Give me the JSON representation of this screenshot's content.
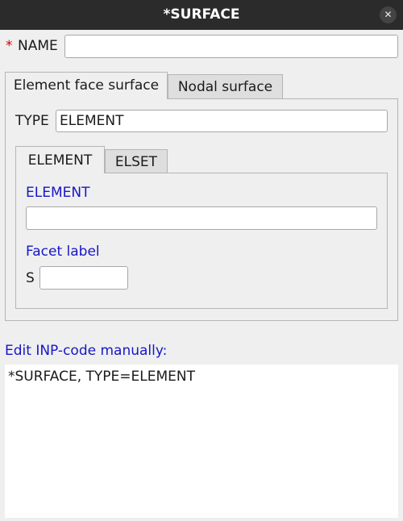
{
  "window": {
    "title": "*SURFACE",
    "close_glyph": "✕"
  },
  "name_field": {
    "required_marker": "*",
    "label": "NAME",
    "value": ""
  },
  "outer_tabs": [
    {
      "label": "Element face surface",
      "active": true
    },
    {
      "label": "Nodal surface",
      "active": false
    }
  ],
  "type_field": {
    "label": "TYPE",
    "value": "ELEMENT"
  },
  "inner_tabs": [
    {
      "label": "ELEMENT",
      "active": true
    },
    {
      "label": "ELSET",
      "active": false
    }
  ],
  "element_section": {
    "label": "ELEMENT",
    "value": ""
  },
  "facet_section": {
    "label": "Facet label",
    "prefix": "S",
    "value": ""
  },
  "code_editor": {
    "label": "Edit INP-code manually:",
    "content": "*SURFACE, TYPE=ELEMENT"
  },
  "colors": {
    "titlebar_bg": "#2b2b2b",
    "required": "#d40000",
    "section_label": "#1616c8",
    "background": "#efefef"
  }
}
